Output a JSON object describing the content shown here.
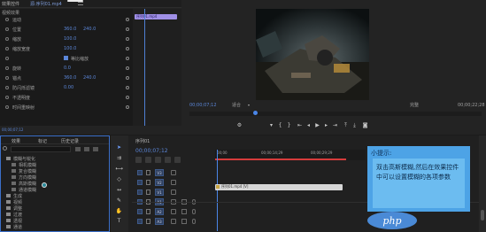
{
  "effects_panel": {
    "tab_controls": "效果控件",
    "tab_source": "源:序列01.mp4",
    "clip_label": "序列01.mp4",
    "section_video": "视频效果",
    "rows": [
      {
        "name": "运动",
        "v1": "",
        "v2": ""
      },
      {
        "name": "位置",
        "v1": "360.0",
        "v2": "240.0"
      },
      {
        "name": "缩放",
        "v1": "100.0",
        "v2": ""
      },
      {
        "name": "缩放宽度",
        "v1": "100.0",
        "v2": ""
      },
      {
        "name": "",
        "v1": "",
        "v2": ""
      },
      {
        "name": "旋转",
        "v1": "0.0",
        "v2": ""
      },
      {
        "name": "锚点",
        "v1": "360.0",
        "v2": "240.0"
      },
      {
        "name": "防闪烁滤镜",
        "v1": "0.00",
        "v2": ""
      },
      {
        "name": "不透明度",
        "v1": "",
        "v2": ""
      },
      {
        "name": "时间重映射",
        "v1": "",
        "v2": ""
      }
    ],
    "uniform_scale_label": "等比缩放",
    "timecode": "00;00;07;12"
  },
  "program_monitor": {
    "current_time": "00;00;07;12",
    "fit_label": "适合",
    "quality": "完整",
    "duration": "00;00;22;28"
  },
  "project_panel": {
    "tabs": [
      "效果",
      "标记",
      "历史记录"
    ],
    "tree_items": [
      "模糊与锐化",
      "相机模糊",
      "复合模糊",
      "方向模糊",
      "高斯模糊",
      "通道模糊",
      "生成",
      "视频",
      "调整",
      "过渡",
      "透视",
      "通道"
    ]
  },
  "timeline": {
    "tab": "序列01",
    "timecode": "00;00;07;12",
    "ruler": [
      "00;00",
      "00;00;14;29",
      "00;00;29;29"
    ],
    "clip_label": "序列01.mp4 [V]",
    "tracks": [
      "V3",
      "V2",
      "V1",
      "A1",
      "A2",
      "A3"
    ]
  },
  "tip_overlay": {
    "title": "小提示:",
    "body": "双击高斯模糊,然后在效果控件中可以设置模糊的各项参数",
    "bg_color": "#4da3e6"
  },
  "watermark": "php"
}
